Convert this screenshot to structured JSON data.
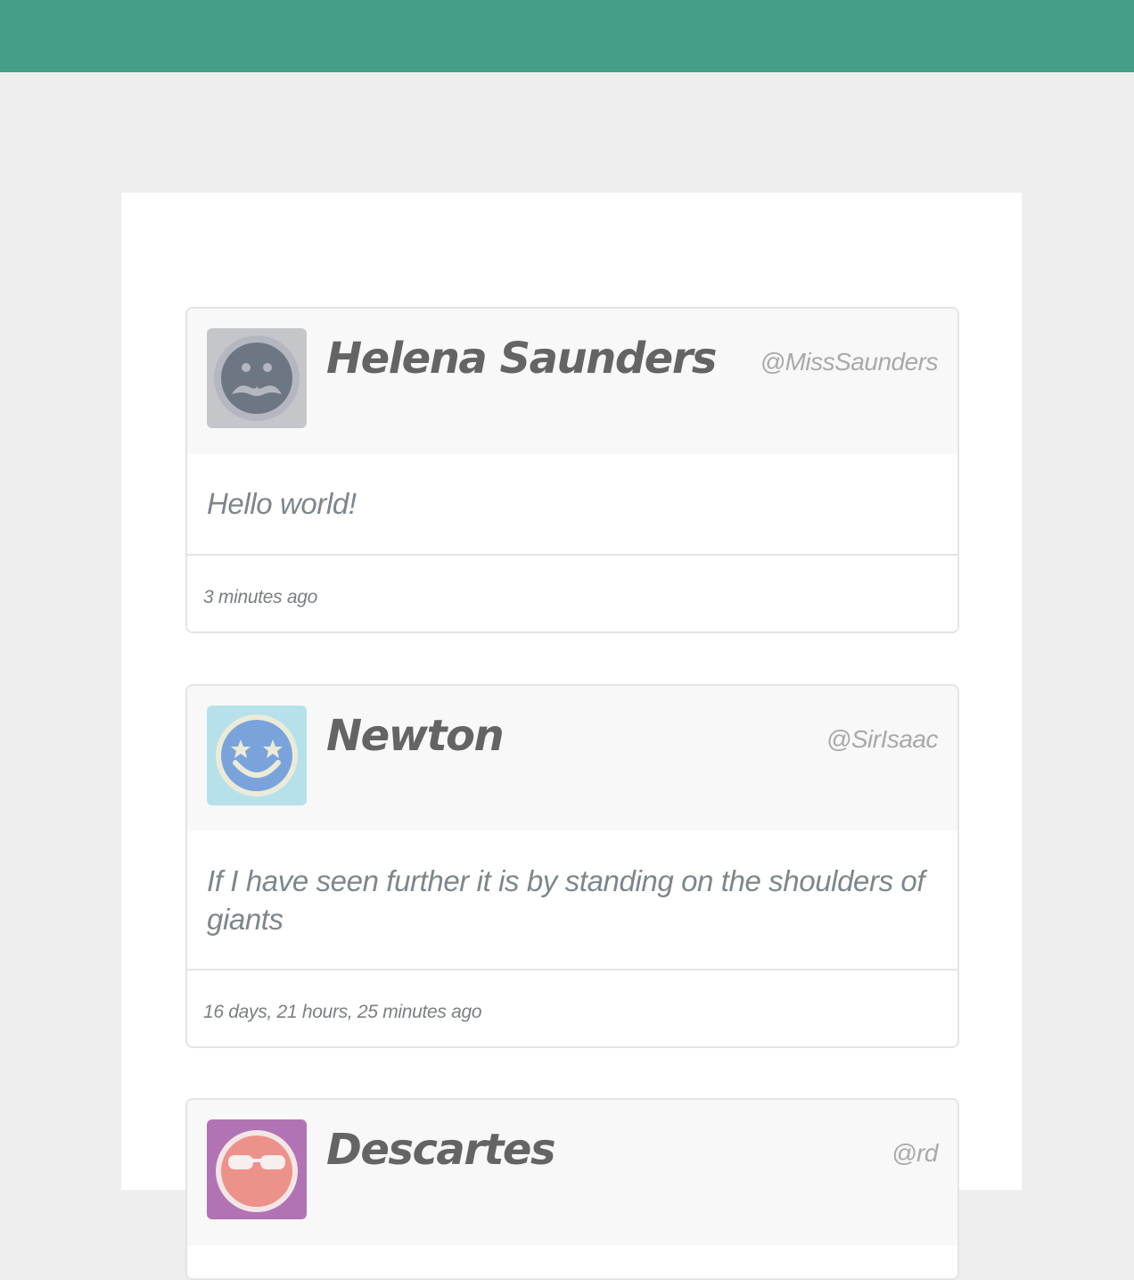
{
  "header": {
    "accent_color": "#479e88"
  },
  "posts": [
    {
      "name": "Helena Saunders",
      "handle": "@MissSaunders",
      "message": "Hello world!",
      "time": "3 minutes ago",
      "avatar": {
        "icon": "mustache-face-icon",
        "bg": "#c5c6ca",
        "face": "#6d7784"
      }
    },
    {
      "name": "Newton",
      "handle": "@SirIsaac",
      "message": "If I have seen further it is by standing on the shoulders of giants",
      "time": "16 days, 21 hours, 25 minutes ago",
      "avatar": {
        "icon": "star-eyes-face-icon",
        "bg": "#b6e1ea",
        "face": "#7aa3dc"
      }
    },
    {
      "name": "Descartes",
      "handle": "@rd",
      "message": "",
      "time": "",
      "avatar": {
        "icon": "sunglasses-face-icon",
        "bg": "#b273b5",
        "face": "#ec928a"
      }
    }
  ]
}
